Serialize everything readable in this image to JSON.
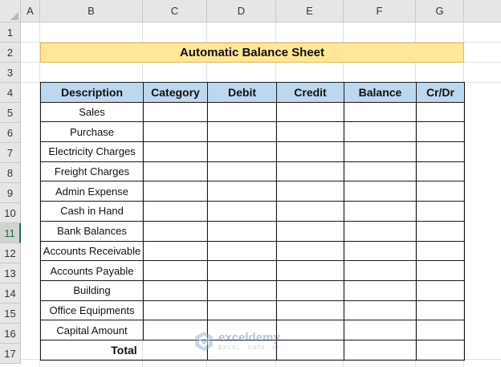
{
  "columns": [
    "A",
    "B",
    "C",
    "D",
    "E",
    "F",
    "G"
  ],
  "rows": [
    "1",
    "2",
    "3",
    "4",
    "5",
    "6",
    "7",
    "8",
    "9",
    "10",
    "11",
    "12",
    "13",
    "14",
    "15",
    "16",
    "17"
  ],
  "active_row": "11",
  "title": "Automatic Balance Sheet",
  "headers": {
    "description": "Description",
    "category": "Category",
    "debit": "Debit",
    "credit": "Credit",
    "balance": "Balance",
    "crdr": "Cr/Dr"
  },
  "items": [
    "Sales",
    "Purchase",
    "Electricity Charges",
    "Freight Charges",
    "Admin Expense",
    "Cash in Hand",
    "Bank Balances",
    "Accounts Receivable",
    "Accounts Payable",
    "Building",
    "Office Equipments",
    "Capital Amount"
  ],
  "total_label": "Total",
  "watermark": {
    "name": "exceldemy",
    "tagline": "EXCEL · DATA · BI",
    "icon": "exceldemy-logo-icon"
  },
  "colors": {
    "title_fill": "#ffe699",
    "header_fill": "#bdd7ee",
    "active_row_accent": "#217346"
  }
}
